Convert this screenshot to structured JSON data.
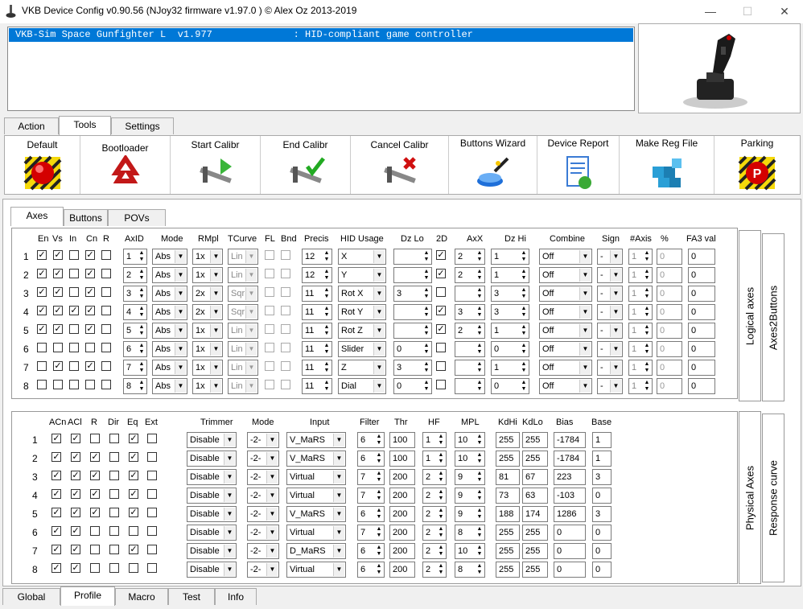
{
  "window": {
    "title": "VKB Device Config v0.90.56 (NJoy32 firmware v1.97.0 ) © Alex Oz 2013-2019",
    "min": "—",
    "max": "☐",
    "close": "✕"
  },
  "device": {
    "selected": "VKB-Sim Space Gunfighter L  v1.977              : HID-compliant game controller"
  },
  "top_tabs": [
    "Action",
    "Tools",
    "Settings"
  ],
  "tools": [
    "Default",
    "Bootloader",
    "Start Calibr",
    "End Calibr",
    "Cancel Calibr",
    "Buttons Wizard",
    "Device Report",
    "Make Reg File",
    "Parking"
  ],
  "sub_tabs": [
    "Axes",
    "Buttons",
    "POVs"
  ],
  "side_logical": [
    "Logical axes",
    "Axes2Buttons"
  ],
  "side_physical": [
    "Physical Axes",
    "Response curve"
  ],
  "logical": {
    "headers": [
      "En",
      "Vs",
      "In",
      "Cn",
      "R",
      "AxID",
      "Mode",
      "RMpl",
      "TCurve",
      "FL",
      "Bnd",
      "Precis",
      "HID Usage",
      "Dz Lo",
      "2D",
      "AxX",
      "Dz Hi",
      "Combine",
      "Sign",
      "#Axis",
      "%",
      "FA3 val"
    ],
    "rows": [
      {
        "n": "1",
        "en": true,
        "vs": true,
        "in": false,
        "cn": true,
        "r": false,
        "axid": "1",
        "mode": "Abs",
        "rmpl": "1x",
        "tcurve": "Lin",
        "fl": false,
        "bnd": false,
        "precis": "12",
        "hid": "X",
        "dzlo": "",
        "d2": true,
        "axx": "2",
        "dzhi": "1",
        "combine": "Off",
        "sign": "-",
        "naxis": "1",
        "pct": "0",
        "fa3": "0"
      },
      {
        "n": "2",
        "en": true,
        "vs": true,
        "in": false,
        "cn": true,
        "r": false,
        "axid": "2",
        "mode": "Abs",
        "rmpl": "1x",
        "tcurve": "Lin",
        "fl": false,
        "bnd": false,
        "precis": "12",
        "hid": "Y",
        "dzlo": "",
        "d2": true,
        "axx": "2",
        "dzhi": "1",
        "combine": "Off",
        "sign": "-",
        "naxis": "1",
        "pct": "0",
        "fa3": "0"
      },
      {
        "n": "3",
        "en": true,
        "vs": true,
        "in": false,
        "cn": true,
        "r": false,
        "axid": "3",
        "mode": "Abs",
        "rmpl": "2x",
        "tcurve": "Sqr",
        "fl": false,
        "bnd": false,
        "precis": "11",
        "hid": "Rot X",
        "dzlo": "3",
        "d2": false,
        "axx": "",
        "dzhi": "3",
        "combine": "Off",
        "sign": "-",
        "naxis": "1",
        "pct": "0",
        "fa3": "0"
      },
      {
        "n": "4",
        "en": true,
        "vs": true,
        "in": true,
        "cn": true,
        "r": false,
        "axid": "4",
        "mode": "Abs",
        "rmpl": "2x",
        "tcurve": "Sqr",
        "fl": false,
        "bnd": false,
        "precis": "11",
        "hid": "Rot Y",
        "dzlo": "",
        "d2": true,
        "axx": "3",
        "dzhi": "3",
        "combine": "Off",
        "sign": "-",
        "naxis": "1",
        "pct": "0",
        "fa3": "0"
      },
      {
        "n": "5",
        "en": true,
        "vs": true,
        "in": false,
        "cn": true,
        "r": false,
        "axid": "5",
        "mode": "Abs",
        "rmpl": "1x",
        "tcurve": "Lin",
        "fl": false,
        "bnd": false,
        "precis": "11",
        "hid": "Rot Z",
        "dzlo": "",
        "d2": true,
        "axx": "2",
        "dzhi": "1",
        "combine": "Off",
        "sign": "-",
        "naxis": "1",
        "pct": "0",
        "fa3": "0"
      },
      {
        "n": "6",
        "en": false,
        "vs": false,
        "in": false,
        "cn": false,
        "r": false,
        "axid": "6",
        "mode": "Abs",
        "rmpl": "1x",
        "tcurve": "Lin",
        "fl": false,
        "bnd": false,
        "precis": "11",
        "hid": "Slider",
        "dzlo": "0",
        "d2": false,
        "axx": "",
        "dzhi": "0",
        "combine": "Off",
        "sign": "-",
        "naxis": "1",
        "pct": "0",
        "fa3": "0"
      },
      {
        "n": "7",
        "en": false,
        "vs": true,
        "in": false,
        "cn": true,
        "r": false,
        "axid": "7",
        "mode": "Abs",
        "rmpl": "1x",
        "tcurve": "Lin",
        "fl": false,
        "bnd": false,
        "precis": "11",
        "hid": "Z",
        "dzlo": "3",
        "d2": false,
        "axx": "",
        "dzhi": "1",
        "combine": "Off",
        "sign": "-",
        "naxis": "1",
        "pct": "0",
        "fa3": "0"
      },
      {
        "n": "8",
        "en": false,
        "vs": false,
        "in": false,
        "cn": false,
        "r": false,
        "axid": "8",
        "mode": "Abs",
        "rmpl": "1x",
        "tcurve": "Lin",
        "fl": false,
        "bnd": false,
        "precis": "11",
        "hid": "Dial",
        "dzlo": "0",
        "d2": false,
        "axx": "",
        "dzhi": "0",
        "combine": "Off",
        "sign": "-",
        "naxis": "1",
        "pct": "0",
        "fa3": "0"
      }
    ]
  },
  "physical": {
    "headers": [
      "ACn",
      "ACl",
      "R",
      "Dir",
      "Eq",
      "Ext",
      "Trimmer",
      "Mode",
      "Input",
      "Filter",
      "Thr",
      "HF",
      "MPL",
      "KdHi",
      "KdLo",
      "Bias",
      "Base"
    ],
    "rows": [
      {
        "n": "1",
        "acn": true,
        "acl": true,
        "r": false,
        "dir": false,
        "eq": true,
        "ext": false,
        "trimmer": "Disable",
        "mode": "-2-",
        "input": "V_MaRS",
        "filter": "6",
        "thr": "100",
        "hf": "1",
        "mpl": "10",
        "kdhi": "255",
        "kdlo": "255",
        "bias": "-1784",
        "base": "1"
      },
      {
        "n": "2",
        "acn": true,
        "acl": true,
        "r": true,
        "dir": false,
        "eq": true,
        "ext": false,
        "trimmer": "Disable",
        "mode": "-2-",
        "input": "V_MaRS",
        "filter": "6",
        "thr": "100",
        "hf": "1",
        "mpl": "10",
        "kdhi": "255",
        "kdlo": "255",
        "bias": "-1784",
        "base": "1"
      },
      {
        "n": "3",
        "acn": true,
        "acl": true,
        "r": true,
        "dir": false,
        "eq": true,
        "ext": false,
        "trimmer": "Disable",
        "mode": "-2-",
        "input": "Virtual",
        "filter": "7",
        "thr": "200",
        "hf": "2",
        "mpl": "9",
        "kdhi": "81",
        "kdlo": "67",
        "bias": "223",
        "base": "3"
      },
      {
        "n": "4",
        "acn": true,
        "acl": true,
        "r": true,
        "dir": false,
        "eq": true,
        "ext": false,
        "trimmer": "Disable",
        "mode": "-2-",
        "input": "Virtual",
        "filter": "7",
        "thr": "200",
        "hf": "2",
        "mpl": "9",
        "kdhi": "73",
        "kdlo": "63",
        "bias": "-103",
        "base": "0"
      },
      {
        "n": "5",
        "acn": true,
        "acl": true,
        "r": true,
        "dir": false,
        "eq": true,
        "ext": false,
        "trimmer": "Disable",
        "mode": "-2-",
        "input": "V_MaRS",
        "filter": "6",
        "thr": "200",
        "hf": "2",
        "mpl": "9",
        "kdhi": "188",
        "kdlo": "174",
        "bias": "1286",
        "base": "3"
      },
      {
        "n": "6",
        "acn": true,
        "acl": true,
        "r": false,
        "dir": false,
        "eq": false,
        "ext": false,
        "trimmer": "Disable",
        "mode": "-2-",
        "input": "Virtual",
        "filter": "7",
        "thr": "200",
        "hf": "2",
        "mpl": "8",
        "kdhi": "255",
        "kdlo": "255",
        "bias": "0",
        "base": "0"
      },
      {
        "n": "7",
        "acn": true,
        "acl": true,
        "r": false,
        "dir": false,
        "eq": true,
        "ext": false,
        "trimmer": "Disable",
        "mode": "-2-",
        "input": "D_MaRS",
        "filter": "6",
        "thr": "200",
        "hf": "2",
        "mpl": "10",
        "kdhi": "255",
        "kdlo": "255",
        "bias": "0",
        "base": "0"
      },
      {
        "n": "8",
        "acn": true,
        "acl": true,
        "r": false,
        "dir": false,
        "eq": false,
        "ext": false,
        "trimmer": "Disable",
        "mode": "-2-",
        "input": "Virtual",
        "filter": "6",
        "thr": "200",
        "hf": "2",
        "mpl": "8",
        "kdhi": "255",
        "kdlo": "255",
        "bias": "0",
        "base": "0"
      }
    ]
  },
  "bottom_tabs": [
    "Global",
    "Profile",
    "Macro",
    "Test",
    "Info"
  ],
  "check": "✓"
}
